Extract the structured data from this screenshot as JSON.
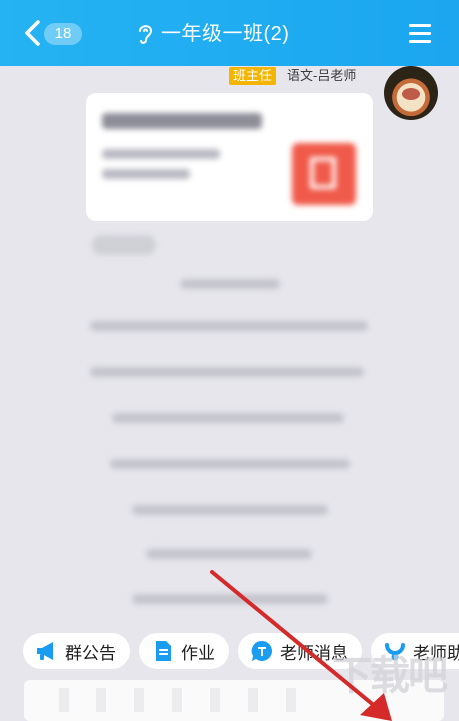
{
  "header": {
    "unread_count": "18",
    "title": "一年级一班(2)"
  },
  "message": {
    "sender_role": "班主任",
    "sender_name": "语文-吕老师"
  },
  "shortcuts": [
    {
      "label": "群公告",
      "icon": "megaphone-icon"
    },
    {
      "label": "作业",
      "icon": "homework-doc-icon"
    },
    {
      "label": "老师消息",
      "icon": "teacher-badge-icon"
    },
    {
      "label": "老师助",
      "icon": "assistant-icon"
    }
  ],
  "watermark": "下载吧",
  "colors": {
    "header_bg": "#1ba6ef",
    "role_tag_bg": "#f5b400",
    "card_icon_bg": "#f05a4a",
    "annotation_arrow": "#d42a2a"
  }
}
